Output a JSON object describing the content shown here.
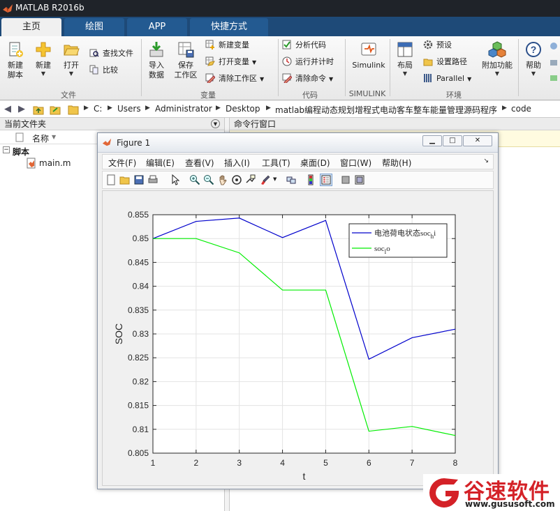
{
  "app": {
    "title": "MATLAB R2016b"
  },
  "tabs": [
    "主页",
    "绘图",
    "APP",
    "快捷方式"
  ],
  "ribbon": {
    "new_script": "新建\n脚本",
    "new": "新建",
    "open": "打开",
    "find_files": "查找文件",
    "compare": "比较",
    "import_data": "导入\n数据",
    "save_workspace": "保存\n工作区",
    "new_variable": "新建变量",
    "open_variable": "打开变量",
    "clear_workspace": "清除工作区",
    "analyze_code": "分析代码",
    "run_and_time": "运行并计时",
    "clear_commands": "清除命令",
    "simulink": "Simulink",
    "layout": "布局",
    "preferences": "预设",
    "set_path": "设置路径",
    "parallel": "Parallel",
    "addons": "附加功能",
    "help": "帮助",
    "groups": {
      "file": "文件",
      "variable": "变量",
      "code": "代码",
      "simulink": "SIMULINK",
      "environment": "环境"
    }
  },
  "address": {
    "crumbs": [
      "C:",
      "Users",
      "Administrator",
      "Desktop",
      "matlab编程动态规划增程式电动客车整车能量管理源码程序",
      "code"
    ]
  },
  "left_panel": {
    "title": "当前文件夹",
    "column_name": "名称",
    "group": "脚本",
    "file": "main.m"
  },
  "right_panel": {
    "title": "命令行窗口"
  },
  "figure": {
    "title": "Figure 1",
    "menus": [
      "文件(F)",
      "编辑(E)",
      "查看(V)",
      "插入(I)",
      "工具(T)",
      "桌面(D)",
      "窗口(W)",
      "帮助(H)"
    ]
  },
  "chart_data": {
    "type": "line",
    "title": "",
    "xlabel": "t",
    "ylabel": "SOC",
    "xlim": [
      1,
      8
    ],
    "ylim": [
      0.805,
      0.855
    ],
    "xticks": [
      "1",
      "2",
      "3",
      "4",
      "5",
      "6",
      "7",
      "8"
    ],
    "yticks": [
      "0.805",
      "0.81",
      "0.815",
      "0.82",
      "0.825",
      "0.83",
      "0.835",
      "0.84",
      "0.845",
      "0.85",
      "0.855"
    ],
    "grid": true,
    "legend_position": "top-right",
    "x": [
      1,
      2,
      3,
      4,
      5,
      6,
      7,
      8
    ],
    "series": [
      {
        "name": "电池荷电状态soc_h_i",
        "color": "#0000cc",
        "values": [
          0.85,
          0.8536,
          0.8543,
          0.8502,
          0.8538,
          0.8247,
          0.8292,
          0.831
        ]
      },
      {
        "name": "soc_l_o",
        "color": "#00ee00",
        "values": [
          0.85,
          0.85,
          0.847,
          0.8392,
          0.8392,
          0.8096,
          0.8106,
          0.8087
        ]
      }
    ]
  },
  "watermark": {
    "brand": "谷速软件",
    "url": "www.gususoft.com",
    "color": "#d42127"
  }
}
